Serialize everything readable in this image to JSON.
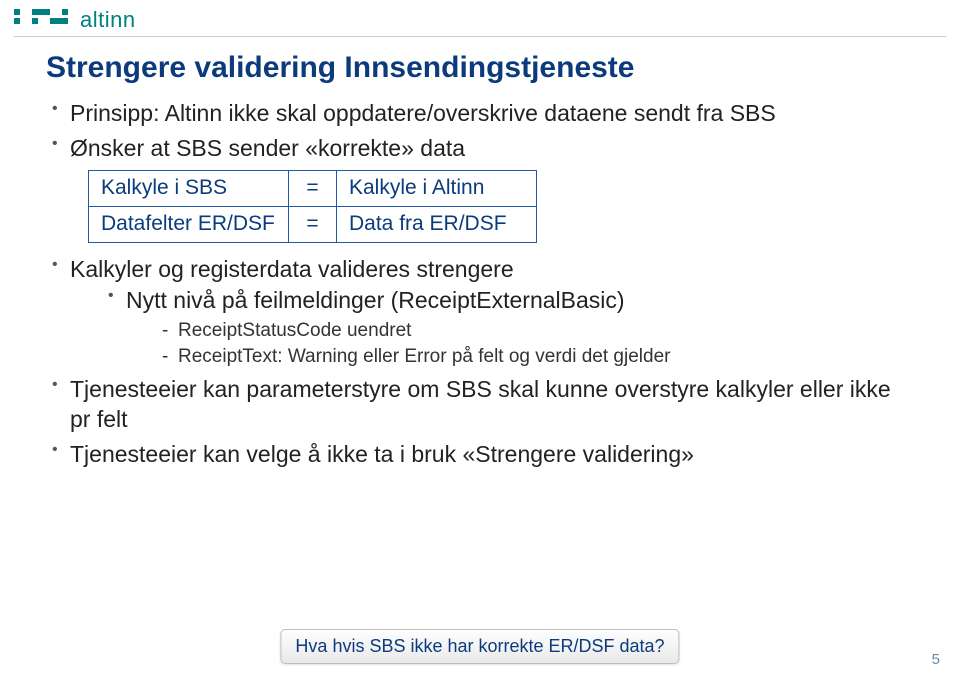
{
  "logo": {
    "text": "altinn"
  },
  "title": "Strengere validering Innsendingstjeneste",
  "bullets": {
    "b1": "Prinsipp: Altinn ikke skal oppdatere/overskrive dataene sendt fra SBS",
    "b2": "Ønsker at SBS sender «korrekte» data",
    "b3": "Kalkyler og registerdata valideres strengere",
    "b3_1": "Nytt nivå på feilmeldinger (ReceiptExternalBasic)",
    "b3_1_a": "ReceiptStatusCode uendret",
    "b3_1_b": "ReceiptText: Warning eller Error på felt og verdi det gjelder",
    "b4": "Tjenesteeier kan parameterstyre om SBS skal kunne overstyre kalkyler eller ikke pr felt",
    "b5": "Tjenesteeier kan velge å ikke ta i bruk «Strengere validering»"
  },
  "table": {
    "rows": [
      {
        "c1": "Kalkyle i SBS",
        "c2": "=",
        "c3": "Kalkyle i Altinn"
      },
      {
        "c1": "Datafelter ER/DSF",
        "c2": "=",
        "c3": "Data fra ER/DSF"
      }
    ]
  },
  "callout": "Hva hvis SBS ikke har korrekte ER/DSF data?",
  "page_number": "5"
}
